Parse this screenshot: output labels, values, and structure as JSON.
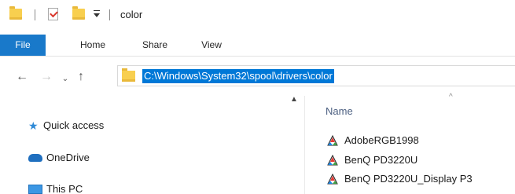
{
  "window": {
    "title": "color"
  },
  "quick_access_toolbar": {
    "items": [
      "folder-icon",
      "properties-icon",
      "new-folder-icon",
      "customize-dropdown"
    ]
  },
  "ribbon": {
    "tabs": [
      {
        "label": "File",
        "active": true
      },
      {
        "label": "Home"
      },
      {
        "label": "Share"
      },
      {
        "label": "View"
      }
    ],
    "file_color": "#1979ca"
  },
  "navigation": {
    "back_icon": "←",
    "forward_icon": "→",
    "recent_icon": "⌄",
    "up_icon": "↑"
  },
  "address_bar": {
    "path": "C:\\Windows\\System32\\spool\\drivers\\color",
    "selection_color": "#0078d7"
  },
  "nav_pane": {
    "items": [
      {
        "label": "Quick access",
        "icon": "star-icon"
      },
      {
        "label": "OneDrive",
        "icon": "cloud-icon"
      },
      {
        "label": "This PC",
        "icon": "computer-icon"
      }
    ]
  },
  "content": {
    "column_header": "Name",
    "files": [
      {
        "name": "AdobeRGB1998",
        "icon": "color-profile-icon"
      },
      {
        "name": "BenQ PD3220U",
        "icon": "color-profile-icon"
      },
      {
        "name": "BenQ PD3220U_Display P3",
        "icon": "color-profile-icon"
      }
    ]
  }
}
